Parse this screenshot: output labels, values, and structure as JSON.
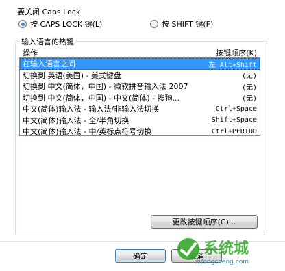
{
  "caps": {
    "title": "要关闭 Caps Lock",
    "option1": "按 CAPS LOCK 键(L)",
    "option2": "按 SHIFT 键(F)"
  },
  "hotkeys": {
    "title": "输入语言的热键",
    "col_action": "操作",
    "col_keys": "按键顺序(K)",
    "rows": [
      {
        "action": "在输入语言之间",
        "keys": "左 Alt+Shift"
      },
      {
        "action": "切换到 英语(美国) - 美式键盘",
        "keys": "(无)"
      },
      {
        "action": "切换到 中文(简体，中国) - 微软拼音输入法 2007",
        "keys": "(无)"
      },
      {
        "action": "切换到 中文(简体，中国) - 中文(简体) - 搜狗...",
        "keys": "(无)"
      },
      {
        "action": "中文(简体)输入法 - 输入法/非输入法切换",
        "keys": "Ctrl+Space"
      },
      {
        "action": "中文(简体)输入法 - 全/半角切换",
        "keys": "Shift+Space"
      },
      {
        "action": "中文(简体)输入法 - 中/英标点符号切换",
        "keys": "Ctrl+PERIOD"
      }
    ],
    "change_button": "更改按键顺序(C)..."
  },
  "footer": {
    "ok": "确定",
    "cancel": "取消"
  },
  "watermark": {
    "text": "系统城",
    "url": "xitongcheng.com"
  },
  "colors": {
    "selection": "#3399ff",
    "watermark_green": "#35a82a"
  }
}
